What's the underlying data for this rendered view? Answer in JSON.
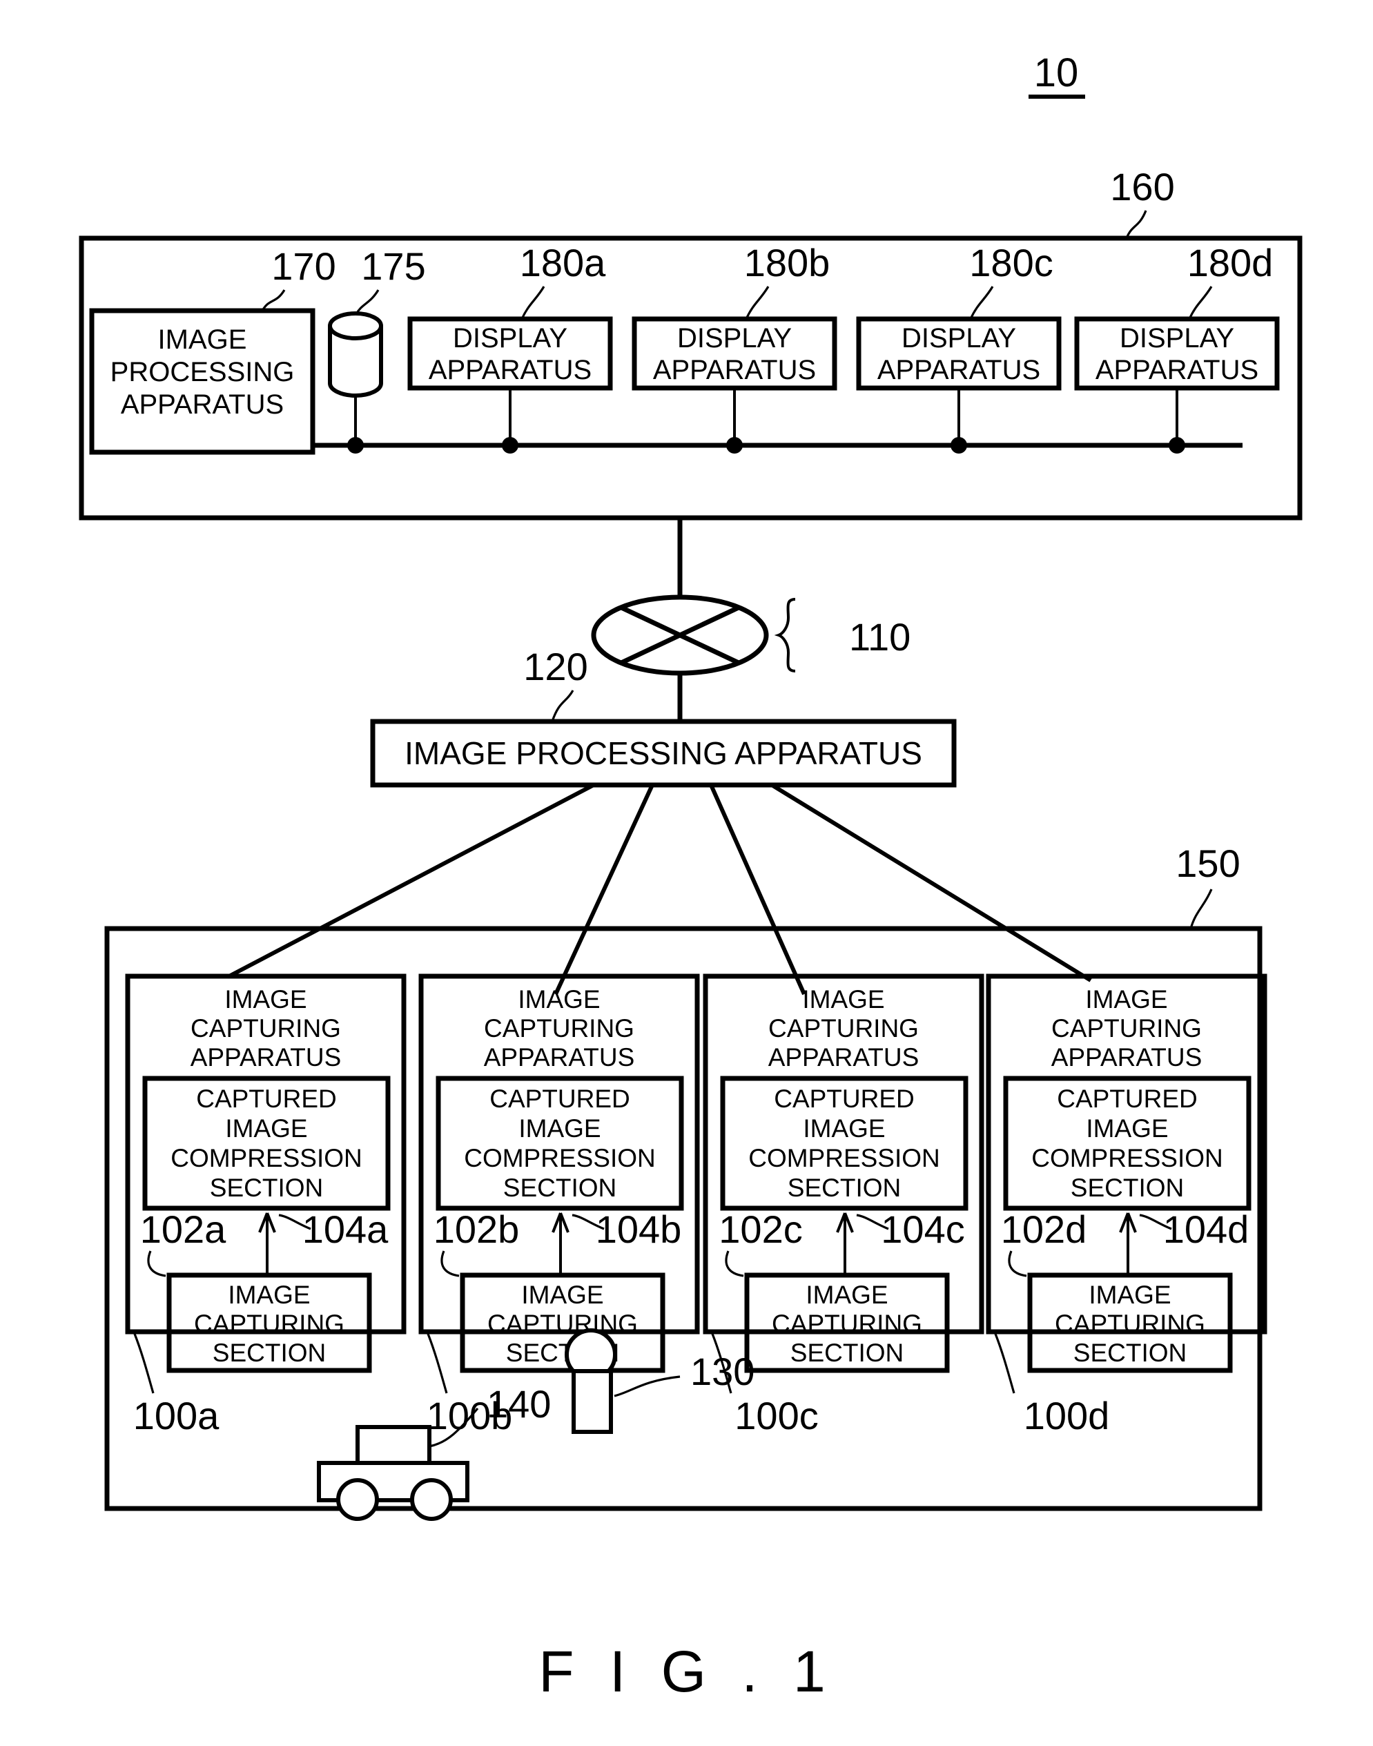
{
  "figure": {
    "caption": "F I G . 1",
    "system_ref": "10"
  },
  "top_section": {
    "ref": "160",
    "image_processing_apparatus": {
      "ref": "170",
      "label_lines": [
        "IMAGE",
        "PROCESSING",
        "APPARATUS"
      ]
    },
    "database": {
      "ref": "175",
      "icon": "cylinder-database-icon"
    },
    "displays": [
      {
        "ref": "180a",
        "label_lines": [
          "DISPLAY",
          "APPARATUS"
        ]
      },
      {
        "ref": "180b",
        "label_lines": [
          "DISPLAY",
          "APPARATUS"
        ]
      },
      {
        "ref": "180c",
        "label_lines": [
          "DISPLAY",
          "APPARATUS"
        ]
      },
      {
        "ref": "180d",
        "label_lines": [
          "DISPLAY",
          "APPARATUS"
        ]
      }
    ]
  },
  "network": {
    "ref": "110",
    "icon": "network-cloud-ellipse-icon"
  },
  "middle_section": {
    "ref": "120",
    "label": "IMAGE PROCESSING APPARATUS"
  },
  "bottom_section": {
    "ref": "150",
    "cameras": [
      {
        "ref": "100a",
        "title_lines": [
          "IMAGE",
          "CAPTURING",
          "APPARATUS"
        ],
        "compression": {
          "ref": "102a",
          "label_lines": [
            "CAPTURED",
            "IMAGE",
            "COMPRESSION",
            "SECTION"
          ]
        },
        "capture": {
          "ref": "104a",
          "label_lines": [
            "IMAGE",
            "CAPTURING",
            "SECTION"
          ]
        }
      },
      {
        "ref": "100b",
        "title_lines": [
          "IMAGE",
          "CAPTURING",
          "APPARATUS"
        ],
        "compression": {
          "ref": "102b",
          "label_lines": [
            "CAPTURED",
            "IMAGE",
            "COMPRESSION",
            "SECTION"
          ]
        },
        "capture": {
          "ref": "104b",
          "label_lines": [
            "IMAGE",
            "CAPTURING",
            "SECTION"
          ]
        }
      },
      {
        "ref": "100c",
        "title_lines": [
          "IMAGE",
          "CAPTURING",
          "APPARATUS"
        ],
        "compression": {
          "ref": "102c",
          "label_lines": [
            "CAPTURED",
            "IMAGE",
            "COMPRESSION",
            "SECTION"
          ]
        },
        "capture": {
          "ref": "104c",
          "label_lines": [
            "IMAGE",
            "CAPTURING",
            "SECTION"
          ]
        }
      },
      {
        "ref": "100d",
        "title_lines": [
          "IMAGE",
          "CAPTURING",
          "APPARATUS"
        ],
        "compression": {
          "ref": "102d",
          "label_lines": [
            "CAPTURED",
            "IMAGE",
            "COMPRESSION",
            "SECTION"
          ]
        },
        "capture": {
          "ref": "104d",
          "label_lines": [
            "IMAGE",
            "CAPTURING",
            "SECTION"
          ]
        }
      }
    ],
    "person": {
      "ref": "130",
      "icon": "person-figure-icon"
    },
    "vehicle": {
      "ref": "140",
      "icon": "car-figure-icon"
    }
  }
}
